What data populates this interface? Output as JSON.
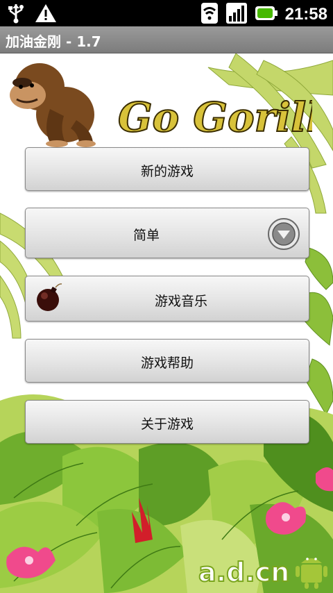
{
  "status_bar": {
    "time": "21:58",
    "icons": [
      "usb-icon",
      "warning-icon",
      "wifi-icon",
      "signal-icon",
      "battery-icon"
    ]
  },
  "app": {
    "title": "加油金刚 - 1.7",
    "logo_text": "Go Gorilla!"
  },
  "menu": {
    "new_game": "新的游戏",
    "difficulty": "简单",
    "music": "游戏音乐",
    "help": "游戏帮助",
    "about": "关于游戏"
  },
  "watermark": "a.d.cn",
  "colors": {
    "status_bar_bg": "#000000",
    "title_bar_bg": "#8a8a8a",
    "button_text": "#111111",
    "logo_yellow": "#d8c23a"
  }
}
